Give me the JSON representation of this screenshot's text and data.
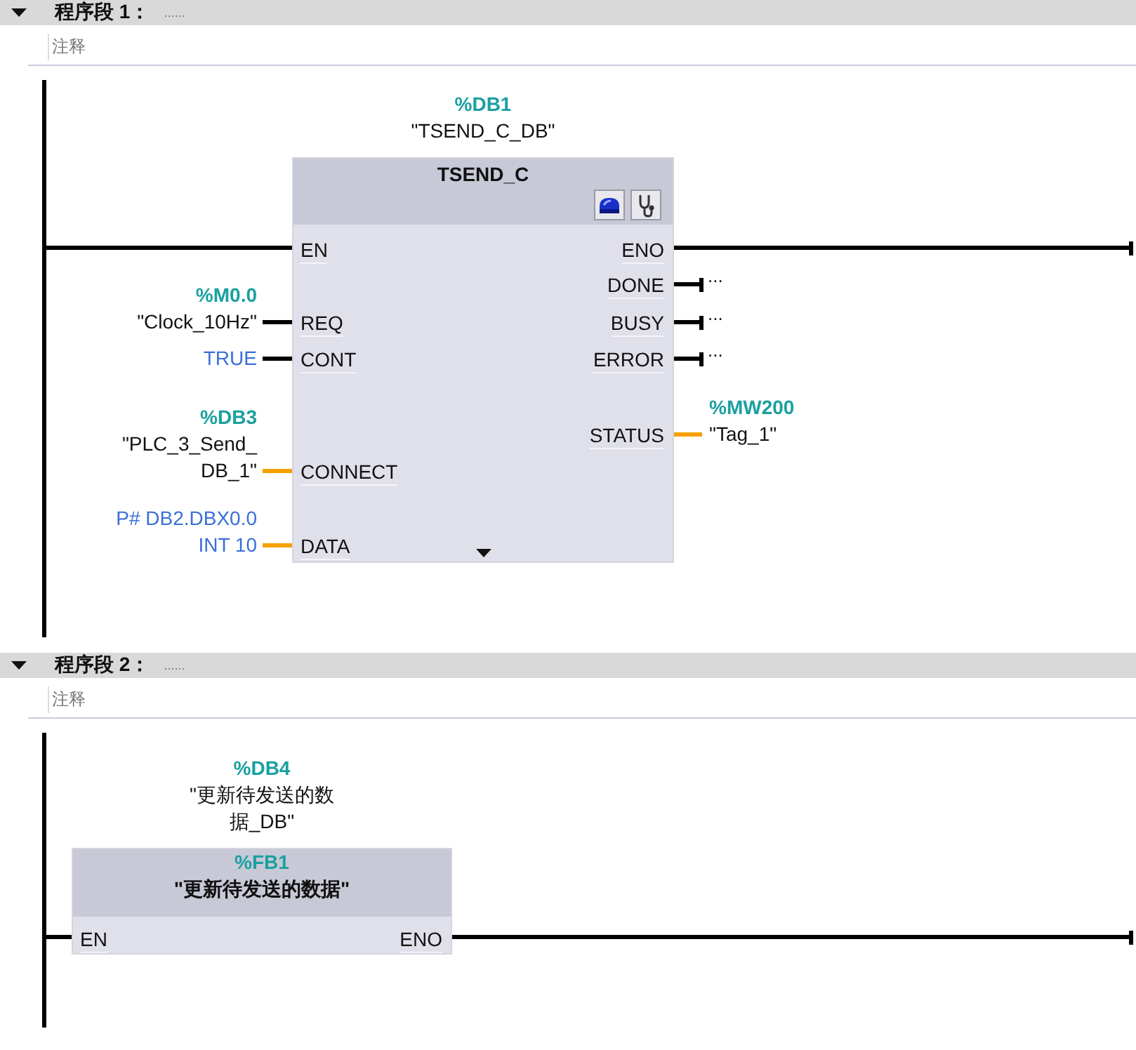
{
  "networks": [
    {
      "title": "程序段 1：",
      "title_hint": "......",
      "expanded": true,
      "comment": "注释",
      "block": {
        "instance": {
          "address": "%DB1",
          "name": "\"TSEND_C_DB\""
        },
        "type": "TSEND_C",
        "has_tools": true,
        "more_pins": true,
        "inputs": [
          {
            "pin": "EN",
            "kind": "power"
          },
          {
            "pin": "REQ",
            "kind": "bool",
            "operand": {
              "address": "%M0.0",
              "name": "\"Clock_10Hz\""
            }
          },
          {
            "pin": "CONT",
            "kind": "bool",
            "operand": {
              "constant": "TRUE"
            }
          },
          {
            "pin": "CONNECT",
            "kind": "param",
            "operand": {
              "address": "%DB3",
              "name": "\"PLC_3_Send_DB_1\""
            }
          },
          {
            "pin": "DATA",
            "kind": "param",
            "operand": {
              "constant": "P# DB2.DBX0.0 INT 10"
            }
          }
        ],
        "outputs": [
          {
            "pin": "ENO",
            "kind": "power"
          },
          {
            "pin": "DONE",
            "kind": "bool",
            "operand": {
              "placeholder": "..."
            }
          },
          {
            "pin": "BUSY",
            "kind": "bool",
            "operand": {
              "placeholder": "..."
            }
          },
          {
            "pin": "ERROR",
            "kind": "bool",
            "operand": {
              "placeholder": "..."
            }
          },
          {
            "pin": "STATUS",
            "kind": "param",
            "operand": {
              "address": "%MW200",
              "name": "\"Tag_1\""
            }
          }
        ]
      }
    },
    {
      "title": "程序段 2：",
      "title_hint": "......",
      "expanded": true,
      "comment": "注释",
      "block": {
        "instance": {
          "address": "%DB4",
          "name": "\"更新待发送的数据_DB\""
        },
        "type_address": "%FB1",
        "type": "\"更新待发送的数据\"",
        "has_tools": false,
        "more_pins": false,
        "inputs": [
          {
            "pin": "EN",
            "kind": "power"
          }
        ],
        "outputs": [
          {
            "pin": "ENO",
            "kind": "power"
          }
        ]
      }
    }
  ]
}
